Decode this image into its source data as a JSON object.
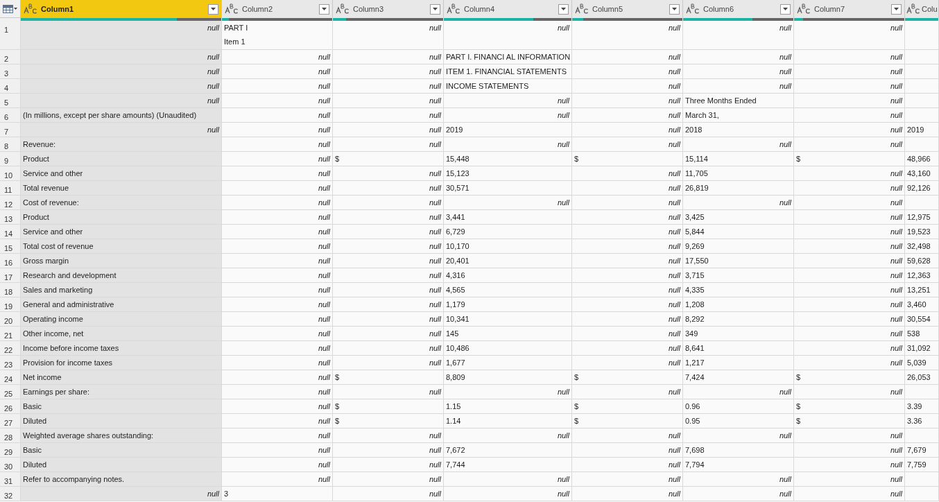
{
  "table": {
    "columns": [
      {
        "name": "Column1",
        "selected": true,
        "level": 0.78
      },
      {
        "name": "Column2",
        "selected": false,
        "level": 0.06
      },
      {
        "name": "Column3",
        "selected": false,
        "level": 0.12
      },
      {
        "name": "Column4",
        "selected": false,
        "level": 0.7
      },
      {
        "name": "Column5",
        "selected": false,
        "level": 0.1
      },
      {
        "name": "Column6",
        "selected": false,
        "level": 0.63
      },
      {
        "name": "Column7",
        "selected": false,
        "level": 0.08
      },
      {
        "name": "Colu",
        "selected": false,
        "level": 1
      }
    ],
    "rows": [
      {
        "number": "1",
        "cells": [
          {
            "kind": "null",
            "text": "null"
          },
          {
            "kind": "lines",
            "lines": [
              "PART I",
              "Item 1"
            ]
          },
          {
            "kind": "null",
            "text": "null"
          },
          {
            "kind": "null",
            "text": "null"
          },
          {
            "kind": "null",
            "text": "null"
          },
          {
            "kind": "null",
            "text": "null"
          },
          {
            "kind": "null",
            "text": "null"
          },
          null
        ]
      },
      {
        "number": "2",
        "cells": [
          {
            "kind": "null",
            "text": "null"
          },
          {
            "kind": "null",
            "text": "null"
          },
          {
            "kind": "null",
            "text": "null"
          },
          "PART I. FINANCI AL INFORMATION",
          {
            "kind": "null",
            "text": "null"
          },
          {
            "kind": "null",
            "text": "null"
          },
          {
            "kind": "null",
            "text": "null"
          },
          null
        ]
      },
      {
        "number": "3",
        "cells": [
          {
            "kind": "null",
            "text": "null"
          },
          {
            "kind": "null",
            "text": "null"
          },
          {
            "kind": "null",
            "text": "null"
          },
          "ITEM 1. FINANCIAL STATEMENTS",
          {
            "kind": "null",
            "text": "null"
          },
          {
            "kind": "null",
            "text": "null"
          },
          {
            "kind": "null",
            "text": "null"
          },
          null
        ]
      },
      {
        "number": "4",
        "cells": [
          {
            "kind": "null",
            "text": "null"
          },
          {
            "kind": "null",
            "text": "null"
          },
          {
            "kind": "null",
            "text": "null"
          },
          "INCOME STATEMENTS",
          {
            "kind": "null",
            "text": "null"
          },
          {
            "kind": "null",
            "text": "null"
          },
          {
            "kind": "null",
            "text": "null"
          },
          null
        ]
      },
      {
        "number": "5",
        "cells": [
          {
            "kind": "null",
            "text": "null"
          },
          {
            "kind": "null",
            "text": "null"
          },
          {
            "kind": "null",
            "text": "null"
          },
          {
            "kind": "null",
            "text": "null"
          },
          {
            "kind": "null",
            "text": "null"
          },
          "Three Months Ended",
          {
            "kind": "null",
            "text": "null"
          },
          null
        ]
      },
      {
        "number": "6",
        "cells": [
          "(In millions, except per share amounts) (Unaudited)",
          {
            "kind": "null",
            "text": "null"
          },
          {
            "kind": "null",
            "text": "null"
          },
          {
            "kind": "null",
            "text": "null"
          },
          {
            "kind": "null",
            "text": "null"
          },
          "March 31,",
          {
            "kind": "null",
            "text": "null"
          },
          null
        ]
      },
      {
        "number": "7",
        "cells": [
          {
            "kind": "null",
            "text": "null"
          },
          {
            "kind": "null",
            "text": "null"
          },
          {
            "kind": "null",
            "text": "null"
          },
          "2019",
          {
            "kind": "null",
            "text": "null"
          },
          "2018",
          {
            "kind": "null",
            "text": "null"
          },
          "2019"
        ]
      },
      {
        "number": "8",
        "cells": [
          "Revenue:",
          {
            "kind": "null",
            "text": "null"
          },
          {
            "kind": "null",
            "text": "null"
          },
          {
            "kind": "null",
            "text": "null"
          },
          {
            "kind": "null",
            "text": "null"
          },
          {
            "kind": "null",
            "text": "null"
          },
          {
            "kind": "null",
            "text": "null"
          },
          null
        ]
      },
      {
        "number": "9",
        "cells": [
          "Product",
          {
            "kind": "null",
            "text": "null"
          },
          "$",
          "15,448",
          "$",
          "15,114",
          "$",
          "48,966"
        ]
      },
      {
        "number": "10",
        "cells": [
          "Service and other",
          {
            "kind": "null",
            "text": "null"
          },
          {
            "kind": "null",
            "text": "null"
          },
          "15,123",
          {
            "kind": "null",
            "text": "null"
          },
          "11,705",
          {
            "kind": "null",
            "text": "null"
          },
          "43,160"
        ]
      },
      {
        "number": "11",
        "cells": [
          "Total revenue",
          {
            "kind": "null",
            "text": "null"
          },
          {
            "kind": "null",
            "text": "null"
          },
          "30,571",
          {
            "kind": "null",
            "text": "null"
          },
          "26,819",
          {
            "kind": "null",
            "text": "null"
          },
          "92,126"
        ]
      },
      {
        "number": "12",
        "cells": [
          "Cost of revenue:",
          {
            "kind": "null",
            "text": "null"
          },
          {
            "kind": "null",
            "text": "null"
          },
          {
            "kind": "null",
            "text": "null"
          },
          {
            "kind": "null",
            "text": "null"
          },
          {
            "kind": "null",
            "text": "null"
          },
          {
            "kind": "null",
            "text": "null"
          },
          null
        ]
      },
      {
        "number": "13",
        "cells": [
          "Product",
          {
            "kind": "null",
            "text": "null"
          },
          {
            "kind": "null",
            "text": "null"
          },
          "3,441",
          {
            "kind": "null",
            "text": "null"
          },
          "3,425",
          {
            "kind": "null",
            "text": "null"
          },
          "12,975"
        ]
      },
      {
        "number": "14",
        "cells": [
          "Service and other",
          {
            "kind": "null",
            "text": "null"
          },
          {
            "kind": "null",
            "text": "null"
          },
          "6,729",
          {
            "kind": "null",
            "text": "null"
          },
          "5,844",
          {
            "kind": "null",
            "text": "null"
          },
          "19,523"
        ]
      },
      {
        "number": "15",
        "cells": [
          "Total cost of revenue",
          {
            "kind": "null",
            "text": "null"
          },
          {
            "kind": "null",
            "text": "null"
          },
          "10,170",
          {
            "kind": "null",
            "text": "null"
          },
          "9,269",
          {
            "kind": "null",
            "text": "null"
          },
          "32,498"
        ]
      },
      {
        "number": "16",
        "cells": [
          "Gross margin",
          {
            "kind": "null",
            "text": "null"
          },
          {
            "kind": "null",
            "text": "null"
          },
          "20,401",
          {
            "kind": "null",
            "text": "null"
          },
          "17,550",
          {
            "kind": "null",
            "text": "null"
          },
          "59,628"
        ]
      },
      {
        "number": "17",
        "cells": [
          "Research and development",
          {
            "kind": "null",
            "text": "null"
          },
          {
            "kind": "null",
            "text": "null"
          },
          "4,316",
          {
            "kind": "null",
            "text": "null"
          },
          "3,715",
          {
            "kind": "null",
            "text": "null"
          },
          "12,363"
        ]
      },
      {
        "number": "18",
        "cells": [
          "Sales and marketing",
          {
            "kind": "null",
            "text": "null"
          },
          {
            "kind": "null",
            "text": "null"
          },
          "4,565",
          {
            "kind": "null",
            "text": "null"
          },
          "4,335",
          {
            "kind": "null",
            "text": "null"
          },
          "13,251"
        ]
      },
      {
        "number": "19",
        "cells": [
          "General and administrative",
          {
            "kind": "null",
            "text": "null"
          },
          {
            "kind": "null",
            "text": "null"
          },
          "1,179",
          {
            "kind": "null",
            "text": "null"
          },
          "1,208",
          {
            "kind": "null",
            "text": "null"
          },
          "3,460"
        ]
      },
      {
        "number": "20",
        "cells": [
          "Operating income",
          {
            "kind": "null",
            "text": "null"
          },
          {
            "kind": "null",
            "text": "null"
          },
          "10,341",
          {
            "kind": "null",
            "text": "null"
          },
          "8,292",
          {
            "kind": "null",
            "text": "null"
          },
          "30,554"
        ]
      },
      {
        "number": "21",
        "cells": [
          "Other income, net",
          {
            "kind": "null",
            "text": "null"
          },
          {
            "kind": "null",
            "text": "null"
          },
          "145",
          {
            "kind": "null",
            "text": "null"
          },
          "349",
          {
            "kind": "null",
            "text": "null"
          },
          "538"
        ]
      },
      {
        "number": "22",
        "cells": [
          "Income before income taxes",
          {
            "kind": "null",
            "text": "null"
          },
          {
            "kind": "null",
            "text": "null"
          },
          "10,486",
          {
            "kind": "null",
            "text": "null"
          },
          "8,641",
          {
            "kind": "null",
            "text": "null"
          },
          "31,092"
        ]
      },
      {
        "number": "23",
        "cells": [
          "Provision for income taxes",
          {
            "kind": "null",
            "text": "null"
          },
          {
            "kind": "null",
            "text": "null"
          },
          "1,677",
          {
            "kind": "null",
            "text": "null"
          },
          "1,217",
          {
            "kind": "null",
            "text": "null"
          },
          "5,039"
        ]
      },
      {
        "number": "24",
        "cells": [
          "Net income",
          {
            "kind": "null",
            "text": "null"
          },
          "$",
          "8,809",
          "$",
          "7,424",
          "$",
          "26,053"
        ]
      },
      {
        "number": "25",
        "cells": [
          "Earnings per share:",
          {
            "kind": "null",
            "text": "null"
          },
          {
            "kind": "null",
            "text": "null"
          },
          {
            "kind": "null",
            "text": "null"
          },
          {
            "kind": "null",
            "text": "null"
          },
          {
            "kind": "null",
            "text": "null"
          },
          {
            "kind": "null",
            "text": "null"
          },
          null
        ]
      },
      {
        "number": "26",
        "cells": [
          "Basic",
          {
            "kind": "null",
            "text": "null"
          },
          "$",
          "1.15",
          "$",
          "0.96",
          "$",
          "3.39"
        ]
      },
      {
        "number": "27",
        "cells": [
          "Diluted",
          {
            "kind": "null",
            "text": "null"
          },
          "$",
          "1.14",
          "$",
          "0.95",
          "$",
          "3.36"
        ]
      },
      {
        "number": "28",
        "cells": [
          "Weighted average shares outstanding:",
          {
            "kind": "null",
            "text": "null"
          },
          {
            "kind": "null",
            "text": "null"
          },
          {
            "kind": "null",
            "text": "null"
          },
          {
            "kind": "null",
            "text": "null"
          },
          {
            "kind": "null",
            "text": "null"
          },
          {
            "kind": "null",
            "text": "null"
          },
          null
        ]
      },
      {
        "number": "29",
        "cells": [
          "Basic",
          {
            "kind": "null",
            "text": "null"
          },
          {
            "kind": "null",
            "text": "null"
          },
          "7,672",
          {
            "kind": "null",
            "text": "null"
          },
          "7,698",
          {
            "kind": "null",
            "text": "null"
          },
          "7,679"
        ]
      },
      {
        "number": "30",
        "cells": [
          "Diluted",
          {
            "kind": "null",
            "text": "null"
          },
          {
            "kind": "null",
            "text": "null"
          },
          "7,744",
          {
            "kind": "null",
            "text": "null"
          },
          "7,794",
          {
            "kind": "null",
            "text": "null"
          },
          "7,759"
        ]
      },
      {
        "number": "31",
        "cells": [
          "Refer to accompanying notes.",
          {
            "kind": "null",
            "text": "null"
          },
          {
            "kind": "null",
            "text": "null"
          },
          {
            "kind": "null",
            "text": "null"
          },
          {
            "kind": "null",
            "text": "null"
          },
          {
            "kind": "null",
            "text": "null"
          },
          {
            "kind": "null",
            "text": "null"
          },
          null
        ]
      },
      {
        "number": "32",
        "cells": [
          {
            "kind": "null",
            "text": "null"
          },
          "3",
          {
            "kind": "null",
            "text": "null"
          },
          {
            "kind": "null",
            "text": "null"
          },
          {
            "kind": "null",
            "text": "null"
          },
          {
            "kind": "null",
            "text": "null"
          },
          {
            "kind": "null",
            "text": "null"
          },
          null
        ]
      }
    ]
  }
}
